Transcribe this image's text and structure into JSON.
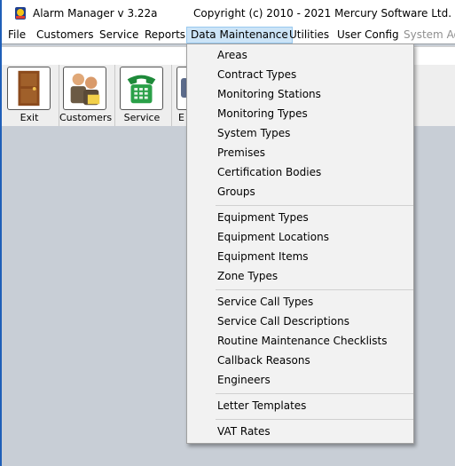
{
  "window": {
    "title": "Alarm Manager v 3.22a",
    "copyright": "Copyright (c) 2010 - 2021 Mercury Software Ltd."
  },
  "menubar": {
    "items": [
      {
        "label": "File"
      },
      {
        "label": "Customers"
      },
      {
        "label": "Service"
      },
      {
        "label": "Reports"
      },
      {
        "label": "Data Maintenance"
      },
      {
        "label": "Utilities"
      },
      {
        "label": "User Config"
      },
      {
        "label": "System Ad"
      }
    ]
  },
  "toolbar": {
    "items": [
      {
        "label": "Exit",
        "icon": "door-icon"
      },
      {
        "label": "Customers",
        "icon": "people-icon"
      },
      {
        "label": "Service",
        "icon": "telephone-icon"
      },
      {
        "label": "E",
        "icon": "clipped-icon"
      }
    ]
  },
  "dropdown": {
    "groups": [
      {
        "items": [
          {
            "label": "Areas"
          },
          {
            "label": "Contract Types"
          },
          {
            "label": "Monitoring Stations"
          },
          {
            "label": "Monitoring Types"
          },
          {
            "label": "System Types"
          },
          {
            "label": "Premises"
          },
          {
            "label": "Certification Bodies"
          },
          {
            "label": "Groups"
          }
        ]
      },
      {
        "items": [
          {
            "label": "Equipment Types"
          },
          {
            "label": "Equipment Locations"
          },
          {
            "label": "Equipment Items"
          },
          {
            "label": "Zone Types"
          }
        ]
      },
      {
        "items": [
          {
            "label": "Service Call Types"
          },
          {
            "label": "Service Call Descriptions"
          },
          {
            "label": "Routine Maintenance Checklists"
          },
          {
            "label": "Callback Reasons"
          },
          {
            "label": "Engineers"
          }
        ]
      },
      {
        "items": [
          {
            "label": "Letter Templates"
          }
        ]
      },
      {
        "items": [
          {
            "label": "VAT Rates"
          }
        ]
      }
    ]
  },
  "colors": {
    "menu_highlight": "#cce4f7",
    "workspace": "#c8ced6",
    "menu_background": "#f2f2f2"
  }
}
